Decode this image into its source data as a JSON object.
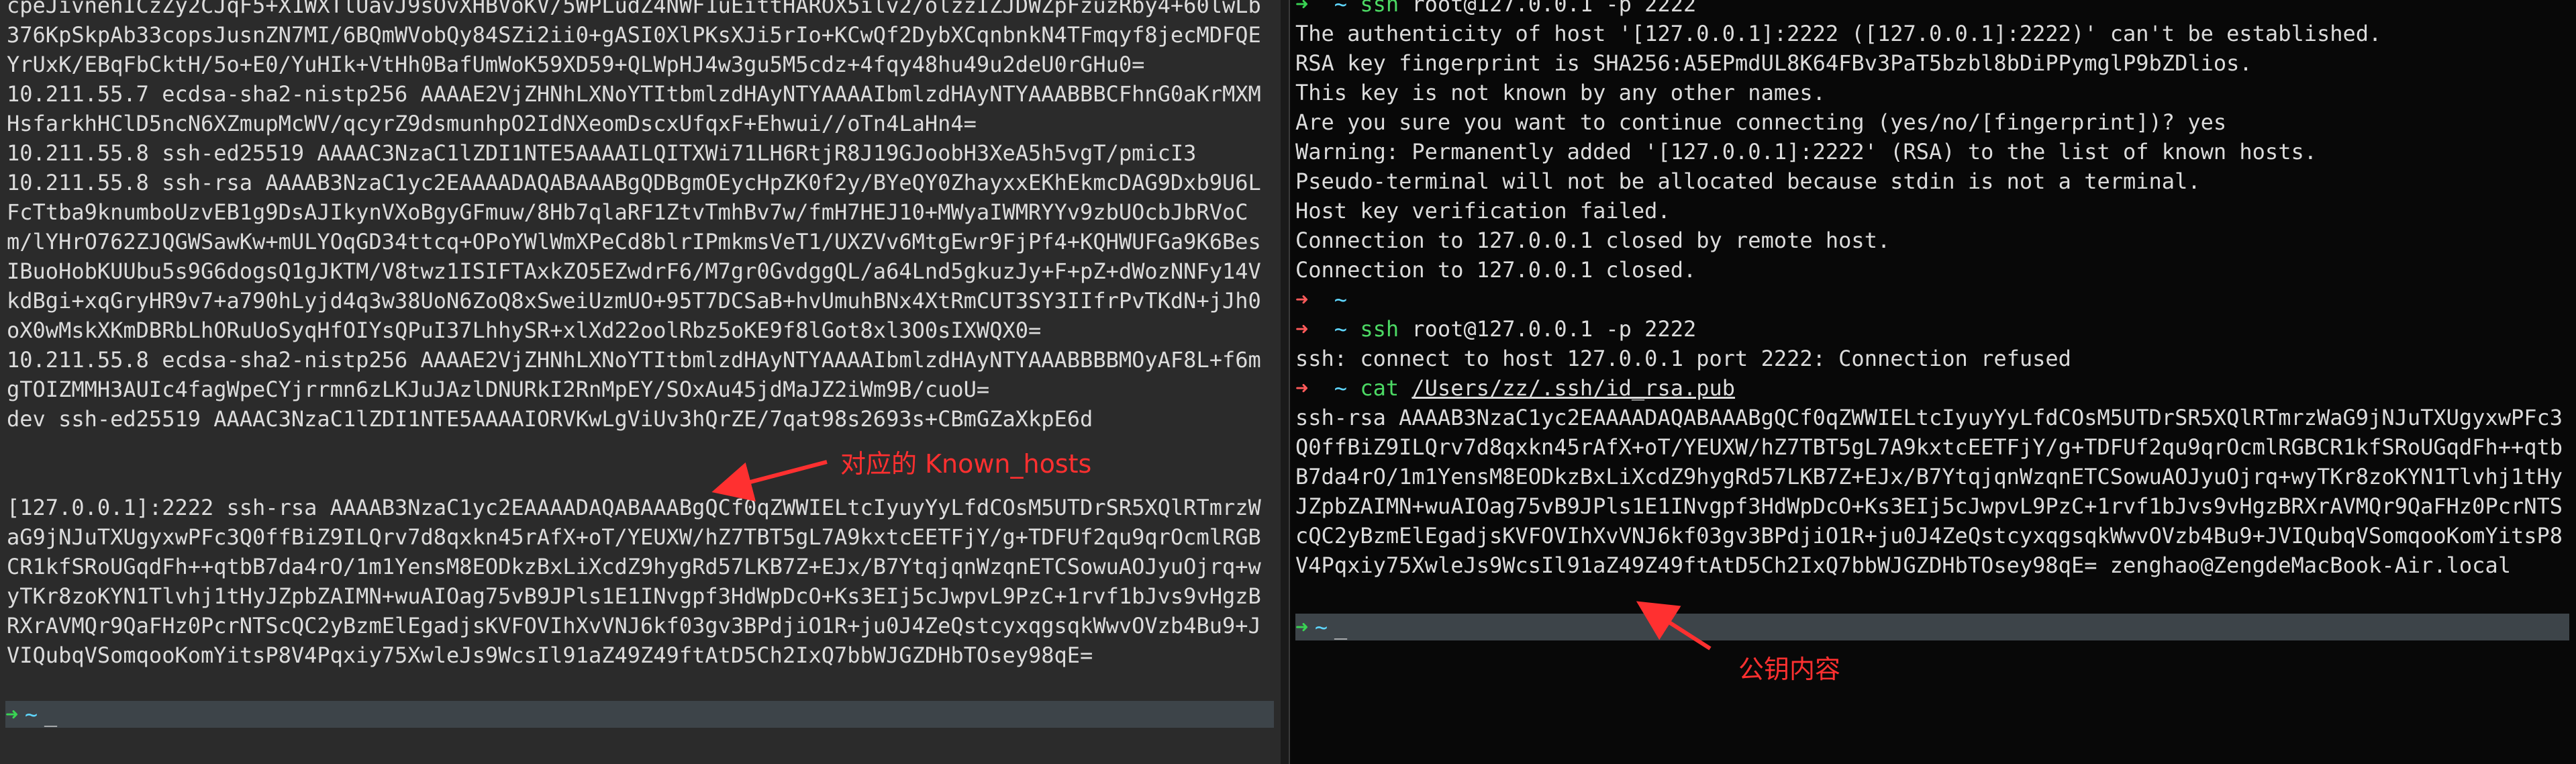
{
  "left_terminal": {
    "lines": [
      "cpeJivnehICzZy2CJqF5+X1WXTlUavJ9sOvXHBVoKV/5WPLudZ4NWF1uEittHAROX5ilv2/olzzIZJDWZpFzuzRby4+60lwLb376KpSkpAb33copsJusnZN7MI/6BQmWVobQy84SZi2ii0+gASI0XlPKsXJi5rIo+KCwQf2DybXCqnbnkN4TFmqyf8jecMDFQEYrUxK/EBqFbCktH/5o+E0/YuHIk+VtHh0BafUmWoK59XD59+QLWpHJ4w3gu5M5cdz+4fqy48hu49u2deU0rGHu0=",
      "10.211.55.7 ecdsa-sha2-nistp256 AAAAE2VjZHNhLXNoYTItbmlzdHAyNTYAAAAIbmlzdHAyNTYAAABBBCFhnG0aKrMXMHsfarkhHClD5ncN6XZmupMcWV/qcyrZ9dsmunhpO2IdNXeomDscxUfqxF+Ehwui//oTn4LaHn4=",
      "10.211.55.8 ssh-ed25519 AAAAC3NzaC1lZDI1NTE5AAAAILQITXWi71LH6RtjR8J19GJoobH3XeA5h5vgT/pmicI3",
      "10.211.55.8 ssh-rsa AAAAB3NzaC1yc2EAAAADAQABAAABgQDBgmOEycHpZK0f2y/BYeQY0ZhayxxEKhEkmcDAG9Dxb9U6LFcTtba9knumboUzvEB1g9DsAJIkynVXoBgyGFmuw/8Hb7qlaRF1ZtvTmhBv7w/fmH7HEJ10+MWyaIWMRYYv9zbUOcbJbRVoCm/lYHrO762ZJQGWSawKw+mULYOqGD34ttcq+OPoYWlWmXPeCd8blrIPmkmsVeT1/UXZVv6MtgEwr9FjPf4+KQHWUFGa9K6BesIBuoHobKUUbu5s9G6dogsQ1gJKTM/V8twz1ISIFTAxkZO5EZwdrF6/M7gr0GvdggQL/a64Lnd5gkuzJy+F+pZ+dWozNNFy14VkdBgi+xqGryHR9v7+a790hLyjd4q3w38UoN6ZoQ8xSweiUzmUO+95T7DCSaB+hvUmuhBNx4XtRmCUT3SY3IIfrPvTKdN+jJh0oX0wMskXKmDBRbLhORuUoSyqHfOIYsQPuI37LhhySR+xlXd22oolRbz5oKE9f8lGot8xl3O0sIXWQX0=",
      "10.211.55.8 ecdsa-sha2-nistp256 AAAAE2VjZHNhLXNoYTItbmlzdHAyNTYAAAAIbmlzdHAyNTYAAABBBBMOyAF8L+f6mgTOIZMMH3AUIc4fagWpeCYjrrmn6zLKJuJAzlDNURkI2RnMpEY/SOxAu45jdMaJZ2iWm9B/cuoU=",
      "dev ssh-ed25519 AAAAC3NzaC1lZDI1NTE5AAAAIORVKwLgViUv3hQrZE/7qat98s2693s+CBmGZaXkpE6d",
      "",
      "",
      "[127.0.0.1]:2222 ssh-rsa AAAAB3NzaC1yc2EAAAADAQABAAABgQCf0qZWWIELtcIyuyYyLfdCOsM5UTDrSR5XQlRTmrzWaG9jNJuTXUgyxwPFc3Q0ffBiZ9ILQrv7d8qxkn45rAfX+oT/YEUXW/hZ7TBT5gL7A9kxtcEETFjY/g+TDFUf2qu9qrOcmlRGBCR1kfSRoUGqdFh++qtbB7da4rO/1m1YensM8EODkzBxLiXcdZ9hygRd57LKB7Z+EJx/B7YtqjqnWzqnETCSowuAOJyuOjrq+wyTKr8zoKYN1Tlvhj1tHyJZpbZAIMN+wuAIOag75vB9JPls1E1INvgpf3HdWpDcO+Ks3EIj5cJwpvL9PzC+1rvf1bJvs9vHgzBRXrAVMQr9QaFHz0PcrNTScQC2yBzmElEgadjsKVFOVIhXvVNJ6kf03gv3BPdjiO1R+ju0J4ZeQstcyxqgsqkWwvOVzb4Bu9+JVIQubqVSomqooKomYitsP8V4Pqxiy75XwleJs9WcsIl91aZ49Z49ftAtD5Ch2IxQ7bbWJGZDHbTOsey98qE="
    ],
    "prompt": {
      "arrow": "➜",
      "dir": "~",
      "cursor": "_"
    }
  },
  "right_terminal": {
    "session1": {
      "command": "ssh",
      "args": " root@127.0.0.1 -p 2222",
      "output": [
        "The authenticity of host '[127.0.0.1]:2222 ([127.0.0.1]:2222)' can't be established.",
        "RSA key fingerprint is SHA256:A5EPmdUL8K64FBv3PaT5bzbl8bDiPPymglP9bZDlios.",
        "This key is not known by any other names.",
        "Are you sure you want to continue connecting (yes/no/[fingerprint])? yes",
        "Warning: Permanently added '[127.0.0.1]:2222' (RSA) to the list of known hosts.",
        "Pseudo-terminal will not be allocated because stdin is not a terminal.",
        "Host key verification failed.",
        "Connection to 127.0.0.1 closed by remote host.",
        "Connection to 127.0.0.1 closed."
      ]
    },
    "empty_prompt": "~",
    "session2": {
      "command": "ssh",
      "args": " root@127.0.0.1 -p 2222",
      "output": "ssh: connect to host 127.0.0.1 port 2222: Connection refused"
    },
    "session3": {
      "command": "cat",
      "path": "/Users/zz/.ssh/id_rsa.pub",
      "output": "ssh-rsa AAAAB3NzaC1yc2EAAAADAQABAAABgQCf0qZWWIELtcIyuyYyLfdCOsM5UTDrSR5XQlRTmrzWaG9jNJuTXUgyxwPFc3Q0ffBiZ9ILQrv7d8qxkn45rAfX+oT/YEUXW/hZ7TBT5gL7A9kxtcEETFjY/g+TDFUf2qu9qrOcmlRGBCR1kfSRoUGqdFh++qtbB7da4rO/1m1YensM8EODkzBxLiXcdZ9hygRd57LKB7Z+EJx/B7YtqjqnWzqnETCSowuAOJyuOjrq+wyTKr8zoKYN1Tlvhj1tHyJZpbZAIMN+wuAIOag75vB9JPls1E1INvgpf3HdWpDcO+Ks3EIj5cJwpvL9PzC+1rvf1bJvs9vHgzBRXrAVMQr9QaFHz0PcrNTScQC2yBzmElEgadjsKVFOVIhXvVNJ6kf03gv3BPdjiO1R+ju0J4ZeQstcyxqgsqkWwvOVzb4Bu9+JVIQubqVSomqooKomYitsP8V4Pqxiy75XwleJs9WcsIl91aZ49Z49ftAtD5Ch2IxQ7bbWJGZDHbTOsey98qE= zenghao@ZengdeMacBook-Air.local"
    },
    "prompt": {
      "arrow": "➜",
      "dir": "~",
      "cursor": "_"
    }
  },
  "annotations": {
    "known_hosts": "对应的 Known_hosts",
    "public_key": "公钥内容"
  },
  "colors": {
    "annotation": "#ff3030",
    "prompt_error": "#ff5a5a",
    "prompt_ok": "#39d353",
    "tilde": "#5fd7ff",
    "command": "#4cd964"
  }
}
